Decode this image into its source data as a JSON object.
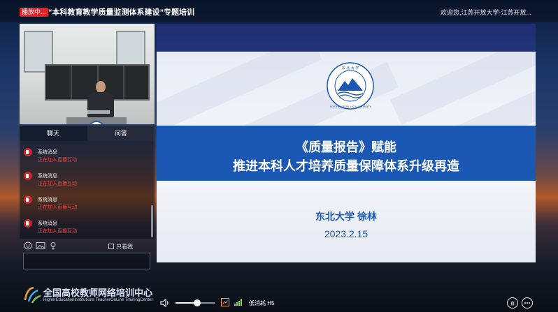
{
  "header": {
    "live_badge": "播放中...",
    "course_title": "“本科教育教学质量监测体系建设”专题培训",
    "welcome": "欢迎您,江苏开放大学-江苏开放..."
  },
  "sidebar": {
    "tabs": [
      {
        "label": "聊天",
        "active": true
      },
      {
        "label": "问答",
        "active": false
      }
    ],
    "messages": [
      {
        "title": "系统消息",
        "text": "正在加入直播互动"
      },
      {
        "title": "系统消息",
        "text": "正在加入直播互动"
      },
      {
        "title": "系统消息",
        "text": "正在加入直播互动"
      },
      {
        "title": "系统消息",
        "text": "正在加入直播互动"
      }
    ],
    "only_me_label": "只看我",
    "toolbar_icons": [
      "emoji-icon",
      "image-icon",
      "flower-icon"
    ]
  },
  "slide": {
    "title_line1": "《质量报告》赋能",
    "title_line2": "推进本科人才培养质量保障体系升级再造",
    "speaker": "东北大学  徐林",
    "date": "2023.2.15",
    "logo_text_ring": "NORTHEASTERN 1923 UNIVERSITY",
    "logo_top_text": "东 北 大 学"
  },
  "brand": {
    "title": "全国高校教师网络培训中心",
    "subtitle": "HigherEducationInstitutions TeacherOnLine TrainingCenter"
  },
  "player": {
    "volume_level": 0.55,
    "mode_label": "低消耗 H5"
  },
  "colors": {
    "live_red": "#e0242a",
    "slide_blue": "#1a58b4",
    "message_red": "#ff3b3b"
  }
}
